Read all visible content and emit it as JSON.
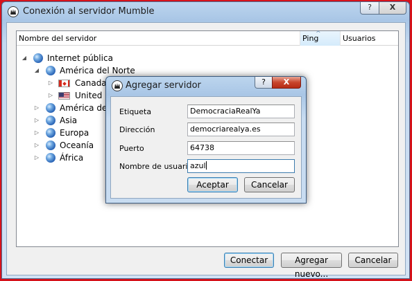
{
  "window": {
    "title": "Conexión al servidor Mumble",
    "help_glyph": "?",
    "close_glyph": "X"
  },
  "columns": {
    "name": "Nombre del servidor",
    "ping": "Ping",
    "users": "Usuarios"
  },
  "tree": {
    "root": {
      "label": "Internet pública",
      "expander": "◢",
      "icon": "globe-icon"
    },
    "north_america": {
      "label": "América del Norte",
      "expander": "◢",
      "icon": "globe-icon"
    },
    "canada": {
      "label": "Canada",
      "expander": "▷",
      "icon": "flag-canada-icon"
    },
    "united_states": {
      "label": "United States",
      "expander": "▷",
      "icon": "flag-usa-icon"
    },
    "south_america": {
      "label": "América del Sur",
      "expander": "▷",
      "icon": "globe-icon"
    },
    "asia": {
      "label": "Asia",
      "expander": "▷",
      "icon": "globe-icon"
    },
    "europe": {
      "label": "Europa",
      "expander": "▷",
      "icon": "globe-icon"
    },
    "oceania": {
      "label": "Oceanía",
      "expander": "▷",
      "icon": "globe-icon"
    },
    "africa": {
      "label": "África",
      "expander": "▷",
      "icon": "globe-icon"
    }
  },
  "buttons": {
    "connect": "Conectar",
    "add_new": "Agregar nuevo...",
    "cancel": "Cancelar"
  },
  "dialog": {
    "title": "Agregar servidor",
    "help_glyph": "?",
    "close_glyph": "X",
    "label_name": "Etiqueta",
    "value_name": "DemocraciaRealYa",
    "label_address": "Dirección",
    "value_address": "democriarealya.es",
    "label_port": "Puerto",
    "value_port": "64738",
    "label_username": "Nombre de usuario",
    "value_username": "azul",
    "accept": "Aceptar",
    "cancel": "Cancelar"
  },
  "colors": {
    "background": "#d6121a",
    "titlebar": "#a9c6e6",
    "close_button": "#c8452c",
    "default_button_border": "#3c7fb1"
  }
}
